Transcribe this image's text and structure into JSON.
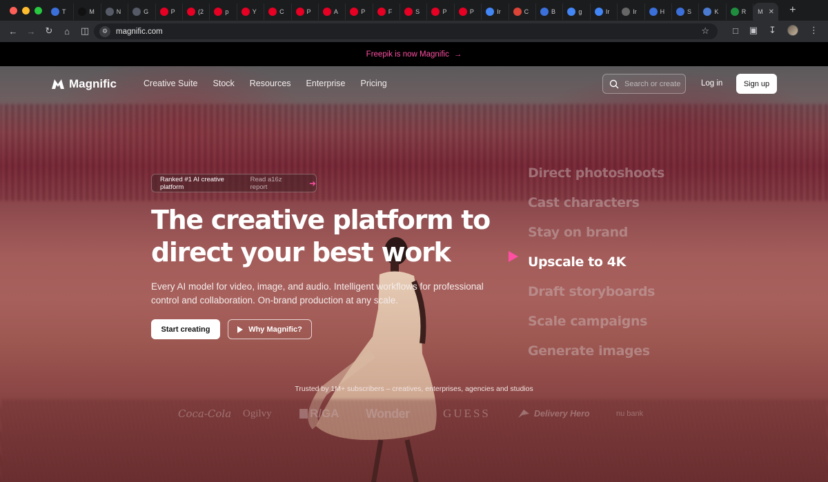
{
  "browser": {
    "tabs": [
      {
        "icon": "document-icon",
        "label": "T",
        "color": "#3b6fd9"
      },
      {
        "icon": "magnific-icon",
        "label": "M",
        "color": "#111111"
      },
      {
        "icon": "globe-icon",
        "label": "N",
        "color": "#555a66"
      },
      {
        "icon": "globe-icon",
        "label": "G",
        "color": "#555a66"
      },
      {
        "icon": "pinterest-icon",
        "label": "P",
        "color": "#e60023"
      },
      {
        "icon": "pinterest-icon",
        "label": "(2",
        "color": "#e60023"
      },
      {
        "icon": "pinterest-icon",
        "label": "p",
        "color": "#e60023"
      },
      {
        "icon": "pinterest-icon",
        "label": "Y",
        "color": "#e60023"
      },
      {
        "icon": "pinterest-icon",
        "label": "C",
        "color": "#e60023"
      },
      {
        "icon": "pinterest-icon",
        "label": "P",
        "color": "#e60023"
      },
      {
        "icon": "pinterest-icon",
        "label": "A",
        "color": "#e60023"
      },
      {
        "icon": "pinterest-icon",
        "label": "P",
        "color": "#e60023"
      },
      {
        "icon": "pinterest-icon",
        "label": "F",
        "color": "#e60023"
      },
      {
        "icon": "pinterest-icon",
        "label": "S",
        "color": "#e60023"
      },
      {
        "icon": "pinterest-icon",
        "label": "P",
        "color": "#e60023"
      },
      {
        "icon": "pinterest-icon",
        "label": "P",
        "color": "#e60023"
      },
      {
        "icon": "google-icon",
        "label": "Ir",
        "color": "#4285f4"
      },
      {
        "icon": "chrome-icon",
        "label": "C",
        "color": "#db4437"
      },
      {
        "icon": "bluetooth-icon",
        "label": "B",
        "color": "#3b6fd9"
      },
      {
        "icon": "google-icon",
        "label": "g",
        "color": "#4285f4"
      },
      {
        "icon": "google-icon",
        "label": "Ir",
        "color": "#4285f4"
      },
      {
        "icon": "openai-icon",
        "label": "Ir",
        "color": "#666666"
      },
      {
        "icon": "globe-icon",
        "label": "H",
        "color": "#3b6fd9"
      },
      {
        "icon": "globe-icon",
        "label": "S",
        "color": "#3b6fd9"
      },
      {
        "icon": "image-icon",
        "label": "K",
        "color": "#4a7bd0"
      },
      {
        "icon": "sheet-icon",
        "label": "R",
        "color": "#1e8e3e"
      }
    ],
    "active_tab": {
      "label": "M",
      "close": "✕"
    },
    "new_tab": "+",
    "url": "magnific.com"
  },
  "announcement": {
    "text": "Freepik is now Magnific",
    "arrow": "→"
  },
  "nav": {
    "brand": "Magnific",
    "items": [
      "Creative Suite",
      "Stock",
      "Resources",
      "Enterprise",
      "Pricing"
    ],
    "search_placeholder": "Search or create",
    "login": "Log in",
    "signup": "Sign up"
  },
  "hero": {
    "pill_primary": "Ranked #1 AI creative platform",
    "pill_secondary": "Read a16z report",
    "headline_line1": "The creative platform to",
    "headline_line2": "direct your best work",
    "subtext": "Every AI model for video, image, and audio. Intelligent workflows for professional control and collaboration. On-brand production at any scale.",
    "cta_primary": "Start creating",
    "cta_secondary": "Why Magnific?"
  },
  "rotator": {
    "items": [
      "Direct photoshoots",
      "Cast characters",
      "Stay on brand",
      "Upscale to 4K",
      "Draft storyboards",
      "Scale campaigns",
      "Generate images"
    ],
    "active_index": 3,
    "active_color": "#ff4fa3"
  },
  "trusted": {
    "text": "Trusted by 1M+ subscribers – creatives, enterprises, agencies and studios",
    "logos": [
      "Coca-Cola",
      "Ogilvy",
      "R/GA",
      "Wonder",
      "GUESS",
      "Delivery Hero",
      "nu bank"
    ]
  },
  "colors": {
    "accent": "#ff4fa3",
    "announce_bg": "#000000"
  }
}
